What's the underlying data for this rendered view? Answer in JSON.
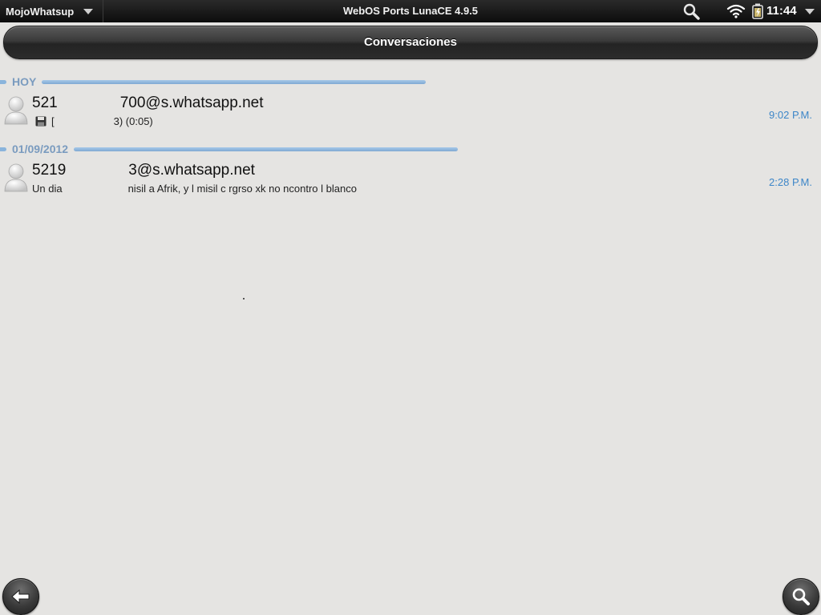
{
  "statusbar": {
    "app_name": "MojoWhatsup",
    "title": "WebOS Ports LunaCE 4.9.5",
    "time": "11:44"
  },
  "header": {
    "title": "Conversaciones"
  },
  "sections": [
    {
      "label": "HOY",
      "conversations": [
        {
          "name_left": "521",
          "name_right": "700@s.whatsapp.net",
          "preview_left": "[",
          "preview_right": "3) (0:05)",
          "time": "9:02 P.M."
        }
      ]
    },
    {
      "label": "01/09/2012",
      "conversations": [
        {
          "name_left": "5219",
          "name_right": "3@s.whatsapp.net",
          "preview_left": "Un dia",
          "preview_right": "nisil a Afrik, y l misil c rgrso xk no ncontro l blanco",
          "time": "2:28 P.M."
        }
      ]
    }
  ],
  "colors": {
    "accent": "#3d86c8",
    "divider": "#8ab4dc",
    "background": "#e5e4e2"
  },
  "icons": {
    "status_search": "search-icon",
    "wifi": "wifi-icon",
    "battery": "battery-icon",
    "back": "back-arrow-icon",
    "search_button": "search-icon"
  }
}
